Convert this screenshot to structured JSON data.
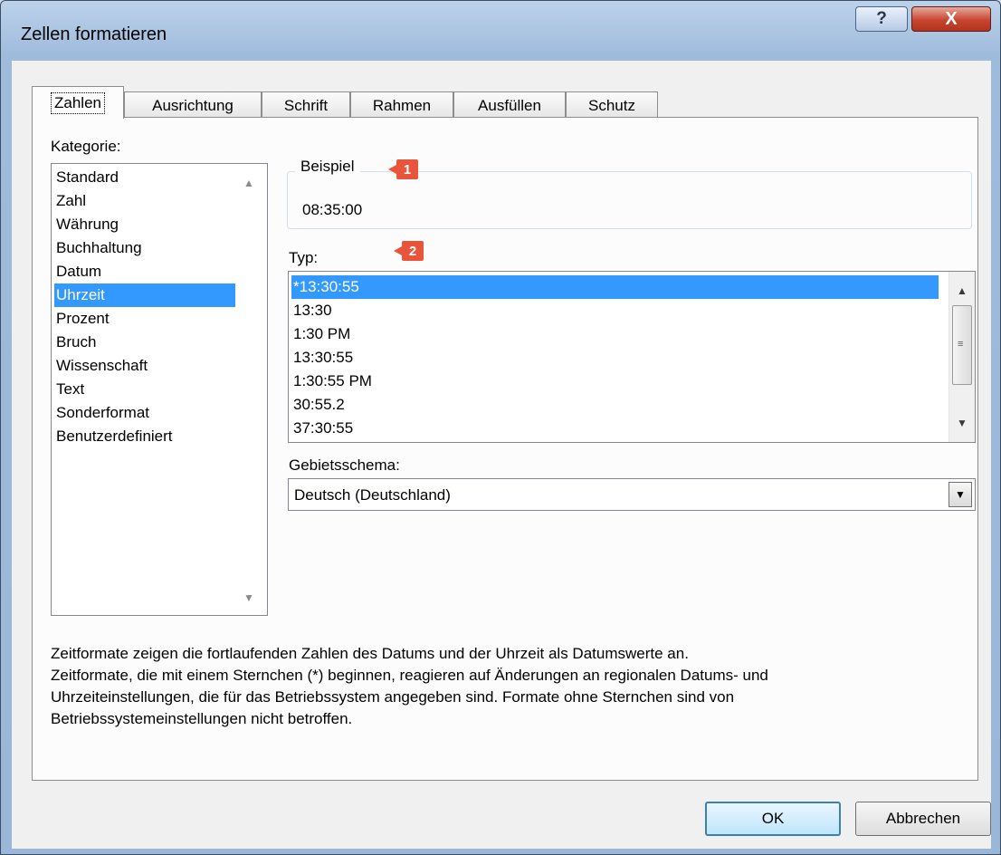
{
  "window": {
    "title": "Zellen formatieren",
    "help_label": "?",
    "close_label": "X"
  },
  "tabs": [
    {
      "label": "Zahlen",
      "active": true
    },
    {
      "label": "Ausrichtung",
      "active": false
    },
    {
      "label": "Schrift",
      "active": false
    },
    {
      "label": "Rahmen",
      "active": false
    },
    {
      "label": "Ausfüllen",
      "active": false
    },
    {
      "label": "Schutz",
      "active": false
    }
  ],
  "category": {
    "label": "Kategorie:",
    "items": [
      "Standard",
      "Zahl",
      "Währung",
      "Buchhaltung",
      "Datum",
      "Uhrzeit",
      "Prozent",
      "Bruch",
      "Wissenschaft",
      "Text",
      "Sonderformat",
      "Benutzerdefiniert"
    ],
    "selected": "Uhrzeit"
  },
  "example": {
    "label": "Beispiel",
    "value": "08:35:00",
    "badge": "1"
  },
  "type": {
    "label": "Typ:",
    "badge": "2",
    "items": [
      "*13:30:55",
      "13:30",
      "1:30 PM",
      "13:30:55",
      "1:30:55 PM",
      "30:55.2",
      "37:30:55"
    ],
    "selected": "*13:30:55"
  },
  "locale": {
    "label": "Gebietsschema:",
    "value": "Deutsch (Deutschland)"
  },
  "description": [
    "Zeitformate zeigen die fortlaufenden Zahlen des Datums und der Uhrzeit als Datumswerte an.",
    "Zeitformate, die mit einem Sternchen (*) beginnen, reagieren auf Änderungen an regionalen Datums- und",
    "Uhrzeiteinstellungen, die für das Betriebssystem angegeben sind. Formate ohne Sternchen sind von",
    "Betriebssystemeinstellungen nicht betroffen."
  ],
  "buttons": {
    "ok": "OK",
    "cancel": "Abbrechen"
  },
  "colors": {
    "selection": "#3399ff",
    "badge": "#e8553a",
    "close": "#c7452f"
  }
}
